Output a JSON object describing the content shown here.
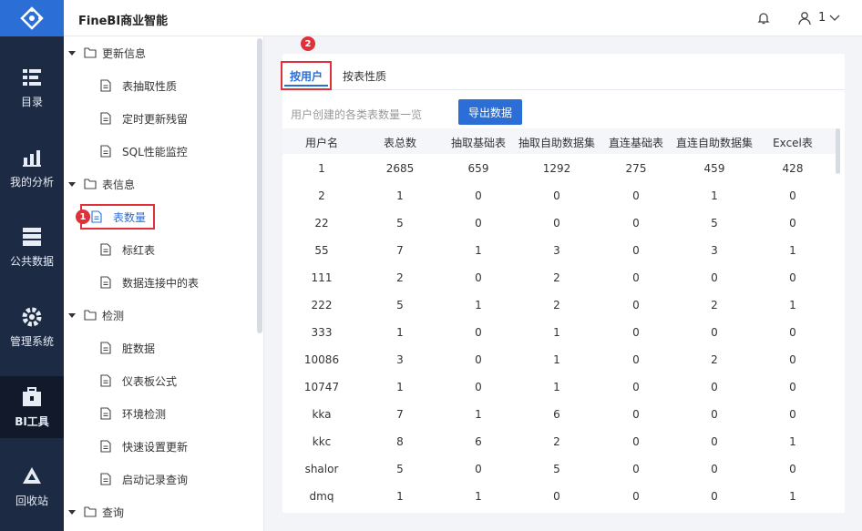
{
  "app": {
    "title": "FineBI商业智能"
  },
  "user": {
    "name": "1"
  },
  "nav": [
    {
      "label": "目录",
      "icon": "catalog-icon"
    },
    {
      "label": "我的分析",
      "icon": "analysis-icon"
    },
    {
      "label": "公共数据",
      "icon": "public-data-icon"
    },
    {
      "label": "管理系统",
      "icon": "management-gear-icon"
    },
    {
      "label": "BI工具",
      "icon": "toolbox-icon",
      "active": true
    },
    {
      "label": "回收站",
      "icon": "recycle-icon"
    }
  ],
  "tree": {
    "groups": [
      {
        "label": "更新信息",
        "items": [
          "表抽取性质",
          "定时更新残留",
          "SQL性能监控"
        ]
      },
      {
        "label": "表信息",
        "items": [
          "表数量",
          "标红表",
          "数据连接中的表"
        ]
      },
      {
        "label": "检测",
        "items": [
          "脏数据",
          "仪表板公式",
          "环境检测",
          "快速设置更新",
          "启动记录查询"
        ]
      },
      {
        "label": "查询",
        "items": []
      }
    ],
    "selected": "表数量",
    "badge1": "1"
  },
  "tabs": {
    "items": [
      "按用户",
      "按表性质"
    ],
    "active": "按用户",
    "badge2": "2"
  },
  "content": {
    "caption": "用户创建的各类表数量一览",
    "export_label": "导出数据"
  },
  "table": {
    "headers": [
      "用户名",
      "表总数",
      "抽取基础表",
      "抽取自助数据集",
      "直连基础表",
      "直连自助数据集",
      "Excel表"
    ],
    "rows": [
      [
        "1",
        "2685",
        "659",
        "1292",
        "275",
        "459",
        "428"
      ],
      [
        "2",
        "1",
        "0",
        "0",
        "0",
        "1",
        "0"
      ],
      [
        "22",
        "5",
        "0",
        "0",
        "0",
        "5",
        "0"
      ],
      [
        "55",
        "7",
        "1",
        "3",
        "0",
        "3",
        "1"
      ],
      [
        "111",
        "2",
        "0",
        "2",
        "0",
        "0",
        "0"
      ],
      [
        "222",
        "5",
        "1",
        "2",
        "0",
        "2",
        "1"
      ],
      [
        "333",
        "1",
        "0",
        "1",
        "0",
        "0",
        "0"
      ],
      [
        "10086",
        "3",
        "0",
        "1",
        "0",
        "2",
        "0"
      ],
      [
        "10747",
        "1",
        "0",
        "1",
        "0",
        "0",
        "0"
      ],
      [
        "kka",
        "7",
        "1",
        "6",
        "0",
        "0",
        "0"
      ],
      [
        "kkc",
        "8",
        "6",
        "2",
        "0",
        "0",
        "1"
      ],
      [
        "shalor",
        "5",
        "0",
        "5",
        "0",
        "0",
        "0"
      ],
      [
        "dmq",
        "1",
        "1",
        "0",
        "0",
        "0",
        "1"
      ]
    ]
  },
  "colors": {
    "accent": "#2b6fd6",
    "nav_bg": "#1c2a44",
    "highlight": "#e0303a"
  }
}
